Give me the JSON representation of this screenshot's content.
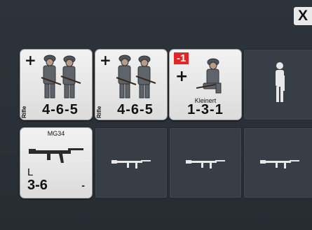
{
  "dialog": {
    "close_label": "X"
  },
  "squads": [
    {
      "type_label": "Rifle",
      "stats": "4-6-5",
      "bonus": "+"
    },
    {
      "type_label": "Rifle",
      "stats": "4-6-5",
      "bonus": "+"
    },
    {
      "modifier": "-1",
      "bonus": "+",
      "name": "Kleinert",
      "stats": "1-3-1"
    }
  ],
  "weapons": [
    {
      "name": "MG34",
      "range_code": "L",
      "stats": "3-6",
      "extra": "-"
    }
  ],
  "empty_slots": {
    "unit": [
      "empty-unit-slot"
    ],
    "weapon": [
      "empty-weapon-slot",
      "empty-weapon-slot",
      "empty-weapon-slot"
    ]
  }
}
